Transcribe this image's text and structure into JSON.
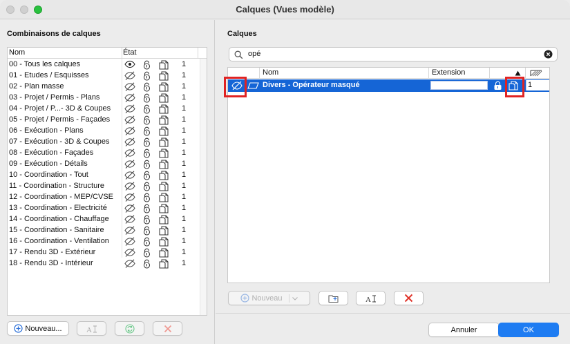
{
  "window": {
    "title": "Calques (Vues modèle)"
  },
  "left": {
    "section_title": "Combinaisons de calques",
    "col_name": "Nom",
    "col_state": "État",
    "rows": [
      {
        "name": "00 - Tous les calques",
        "visible": true,
        "count": "1"
      },
      {
        "name": "01 - Etudes / Esquisses",
        "visible": false,
        "count": "1"
      },
      {
        "name": "02 - Plan masse",
        "visible": false,
        "count": "1"
      },
      {
        "name": "03 - Projet / Permis - Plans",
        "visible": false,
        "count": "1"
      },
      {
        "name": "04 - Projet / P...- 3D & Coupes",
        "visible": false,
        "count": "1"
      },
      {
        "name": "05 - Projet / Permis - Façades",
        "visible": false,
        "count": "1"
      },
      {
        "name": "06 - Exécution - Plans",
        "visible": false,
        "count": "1"
      },
      {
        "name": "07 - Exécution - 3D & Coupes",
        "visible": false,
        "count": "1"
      },
      {
        "name": "08 - Exécution - Façades",
        "visible": false,
        "count": "1"
      },
      {
        "name": "09 - Exécution - Détails",
        "visible": false,
        "count": "1"
      },
      {
        "name": "10 - Coordination - Tout",
        "visible": false,
        "count": "1"
      },
      {
        "name": "11 - Coordination - Structure",
        "visible": false,
        "count": "1"
      },
      {
        "name": "12 - Coordination - MEP/CVSE",
        "visible": false,
        "count": "1"
      },
      {
        "name": "13 - Coordination - Electricité",
        "visible": false,
        "count": "1"
      },
      {
        "name": "14 - Coordination - Chauffage",
        "visible": false,
        "count": "1"
      },
      {
        "name": "15 - Coordination - Sanitaire",
        "visible": false,
        "count": "1"
      },
      {
        "name": "16 - Coordination - Ventilation",
        "visible": false,
        "count": "1"
      },
      {
        "name": "17 - Rendu 3D - Extérieur",
        "visible": false,
        "count": "1"
      },
      {
        "name": "18 - Rendu 3D - Intérieur",
        "visible": false,
        "count": "1"
      }
    ],
    "new_button": "Nouveau..."
  },
  "right": {
    "section_title": "Calques",
    "search_value": "opé",
    "col_name": "Nom",
    "col_extension": "Extension",
    "layer": {
      "name": "Divers - Opérateur masqué",
      "extension": "",
      "number": "1"
    },
    "new_button": "Nouveau",
    "cancel_button": "Annuler",
    "ok_button": "OK"
  },
  "colors": {
    "accent": "#1e7cf2",
    "selection": "#1565d6",
    "highlight_box": "#e02323",
    "delete_x": "#e0352b",
    "refresh": "#27ae60"
  }
}
